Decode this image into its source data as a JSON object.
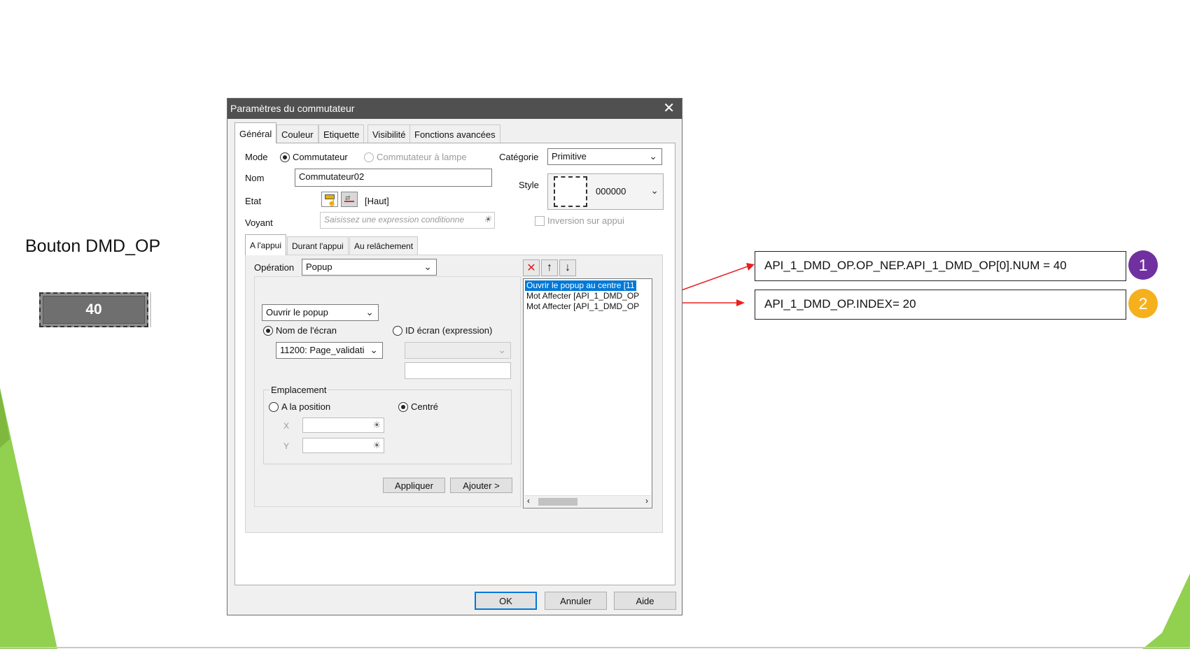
{
  "slide": {
    "label": "Bouton DMD_OP",
    "preview_value": "40"
  },
  "dialog": {
    "title": "Paramètres du commutateur",
    "close_glyph": "✕",
    "tabs": [
      "Général",
      "Couleur",
      "Etiquette",
      "Visibilité",
      "Fonctions avancées"
    ],
    "active_tab": "Général",
    "mode": {
      "label": "Mode",
      "option1": "Commutateur",
      "option2": "Commutateur à lampe",
      "selected": "Commutateur"
    },
    "categorie": {
      "label": "Catégorie",
      "value": "Primitive"
    },
    "nom": {
      "label": "Nom",
      "value": "Commutateur02"
    },
    "style": {
      "label": "Style",
      "value": "000000"
    },
    "etat": {
      "label": "Etat",
      "value": "[Haut]"
    },
    "voyant": {
      "label": "Voyant",
      "placeholder": "Saisissez une expression conditionne"
    },
    "inversion": {
      "label": "Inversion sur appui",
      "checked": false
    },
    "subtabs": [
      "A l'appui",
      "Durant l'appui",
      "Au relâchement"
    ],
    "active_subtab": "A l'appui",
    "operation": {
      "label": "Opération",
      "value": "Popup"
    },
    "popup_action": {
      "value": "Ouvrir le popup"
    },
    "screen_choice": {
      "option1": "Nom de l'écran",
      "option2": "ID écran (expression)",
      "selected": "Nom de l'écran",
      "screen_value": "11200: Page_validati"
    },
    "emplacement": {
      "label": "Emplacement",
      "option1": "A la position",
      "option2": "Centré",
      "selected": "Centré",
      "x_label": "X",
      "y_label": "Y"
    },
    "action_list": [
      "Ouvrir le popup au centre [11",
      "Mot Affecter [API_1_DMD_OP",
      "Mot Affecter [API_1_DMD_OP"
    ],
    "buttons": {
      "appliquer": "Appliquer",
      "ajouter": "Ajouter >",
      "ok": "OK",
      "annuler": "Annuler",
      "aide": "Aide"
    }
  },
  "annotations": [
    {
      "number": "1",
      "text": "API_1_DMD_OP.OP_NEP.API_1_DMD_OP[0].NUM = 40",
      "color": "#7030a0"
    },
    {
      "number": "2",
      "text": "API_1_DMD_OP.INDEX= 20",
      "color": "#f5b01c"
    }
  ],
  "colors": {
    "accent_green": "#92d050",
    "arrow_red": "#e82020",
    "titlebar": "#505050",
    "selection": "#0078d7"
  }
}
